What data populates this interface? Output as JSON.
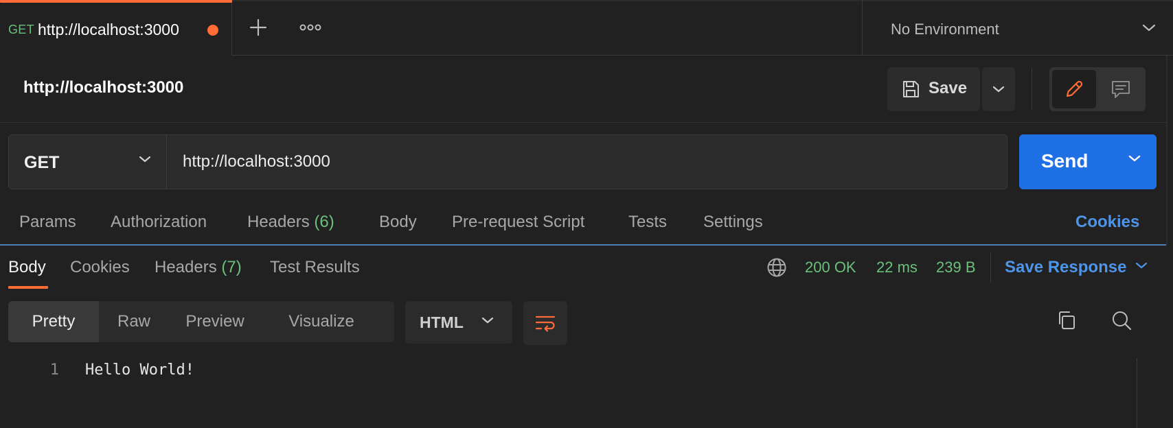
{
  "tabs": [
    {
      "method": "GET",
      "title": "http://localhost:3000",
      "unsaved": true
    }
  ],
  "tabbar": {
    "new_tab_icon": "plus-icon",
    "more_icon": "ellipsis-icon"
  },
  "environment": {
    "label": "No Environment"
  },
  "request": {
    "name": "http://localhost:3000",
    "method": "GET",
    "url": "http://localhost:3000",
    "save_label": "Save",
    "send_label": "Send",
    "tabs": [
      {
        "label": "Params"
      },
      {
        "label": "Authorization"
      },
      {
        "label": "Headers",
        "count": "(6)"
      },
      {
        "label": "Body"
      },
      {
        "label": "Pre-request Script"
      },
      {
        "label": "Tests"
      },
      {
        "label": "Settings"
      }
    ],
    "cookies_label": "Cookies"
  },
  "response": {
    "tabs": [
      {
        "label": "Body",
        "active": true
      },
      {
        "label": "Cookies"
      },
      {
        "label": "Headers",
        "count": "(7)"
      },
      {
        "label": "Test Results"
      }
    ],
    "status": "200 OK",
    "time": "22 ms",
    "size": "239 B",
    "save_response_label": "Save Response",
    "view_modes": [
      "Pretty",
      "Raw",
      "Preview",
      "Visualize"
    ],
    "active_view_mode": "Pretty",
    "format": "HTML",
    "lines": [
      {
        "num": "1",
        "text": "Hello World!"
      }
    ]
  },
  "colors": {
    "accent_orange": "#ff6c37",
    "send_blue": "#1f70e5",
    "link_blue": "#4e95e9",
    "status_green": "#6bc17c",
    "background": "#212121"
  }
}
